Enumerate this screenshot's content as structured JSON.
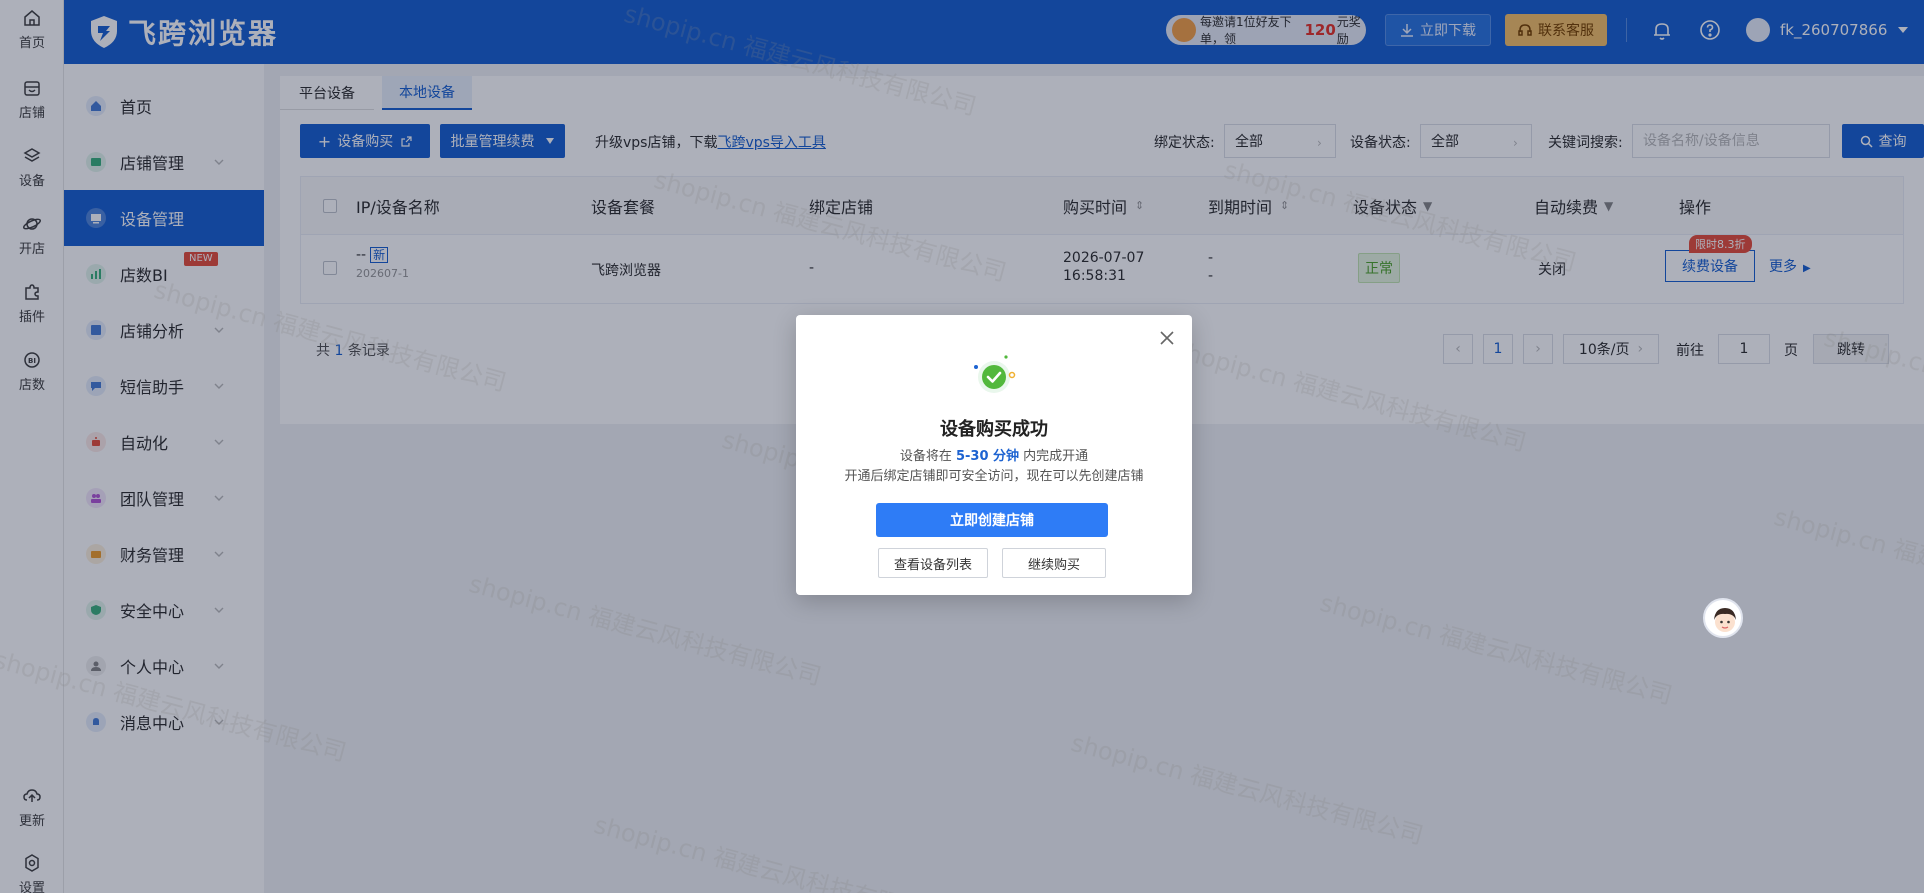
{
  "rail": {
    "items": [
      {
        "label": "首页",
        "icon": "home-icon"
      },
      {
        "label": "店铺",
        "icon": "store-icon"
      },
      {
        "label": "设备",
        "icon": "layers-icon"
      },
      {
        "label": "开店",
        "icon": "planet-icon"
      },
      {
        "label": "插件",
        "icon": "puzzle-icon"
      },
      {
        "label": "店数",
        "icon": "bi-icon"
      },
      {
        "label": "更新",
        "icon": "cloud-update-icon"
      },
      {
        "label": "设置",
        "icon": "settings-icon"
      }
    ]
  },
  "header": {
    "logo_text": "飞跨浏览器",
    "promo": {
      "prefix": "每邀请1位好友下单，领",
      "amount": "120",
      "suffix": "元奖励"
    },
    "download_label": "立即下载",
    "service_label": "联系客服",
    "username": "fk_260707866"
  },
  "sidebar": {
    "items": [
      {
        "label": "首页",
        "color": "#4a7fd6"
      },
      {
        "label": "店铺管理",
        "color": "#3fb37f"
      },
      {
        "label": "设备管理",
        "color": "#ffffff"
      },
      {
        "label": "店数BI",
        "color": "#3fb37f",
        "badge": "NEW"
      },
      {
        "label": "店铺分析",
        "color": "#4a7fd6"
      },
      {
        "label": "短信助手",
        "color": "#4a7fd6"
      },
      {
        "label": "自动化",
        "color": "#e8523e"
      },
      {
        "label": "团队管理",
        "color": "#b45ad6"
      },
      {
        "label": "财务管理",
        "color": "#f0a030"
      },
      {
        "label": "安全中心",
        "color": "#3fb37f"
      },
      {
        "label": "个人中心",
        "color": "#888888"
      },
      {
        "label": "消息中心",
        "color": "#4a7fd6"
      }
    ]
  },
  "tabs": [
    "平台设备",
    "本地设备"
  ],
  "toolbar": {
    "buy_label": "设备购买",
    "batch_label": "批量管理续费",
    "upgrade_text": "升级vps店铺，下载",
    "upgrade_link": "飞跨vps导入工具",
    "bind_label": "绑定状态:",
    "bind_value": "全部",
    "device_status_label": "设备状态:",
    "device_status_value": "全部",
    "keyword_label": "关键词搜索:",
    "keyword_placeholder": "设备名称/设备信息",
    "query_label": "查询"
  },
  "table": {
    "headers": [
      "IP/设备名称",
      "设备套餐",
      "绑定店铺",
      "购买时间",
      "到期时间",
      "设备状态",
      "自动续费",
      "操作"
    ],
    "rows": [
      {
        "name": "--",
        "new_tag": "新",
        "sub": "202607-1",
        "plan": "飞跨浏览器",
        "shop": "-",
        "buy_date": "2026-07-07",
        "buy_time": "16:58:31",
        "expire_1": "-",
        "expire_2": "-",
        "status": "正常",
        "auto_renew": "关闭",
        "discount": "限时8.3折",
        "renew_label": "续费设备",
        "more_label": "更多"
      }
    ]
  },
  "pagination": {
    "total_prefix": "共",
    "total": "1",
    "total_suffix": "条记录",
    "current": "1",
    "page_size": "10条/页",
    "goto_label": "前往",
    "goto_value": "1",
    "page_label": "页",
    "jump_label": "跳转"
  },
  "modal": {
    "title": "设备购买成功",
    "line1_prefix": "设备将在",
    "line1_highlight": "5-30 分钟",
    "line1_suffix": "内完成开通",
    "line2": "开通后绑定店铺即可安全访问，现在可以先创建店铺",
    "primary_label": "立即创建店铺",
    "view_label": "查看设备列表",
    "continue_label": "继续购买"
  },
  "watermark": "shopip.cn 福建云风科技有限公司"
}
